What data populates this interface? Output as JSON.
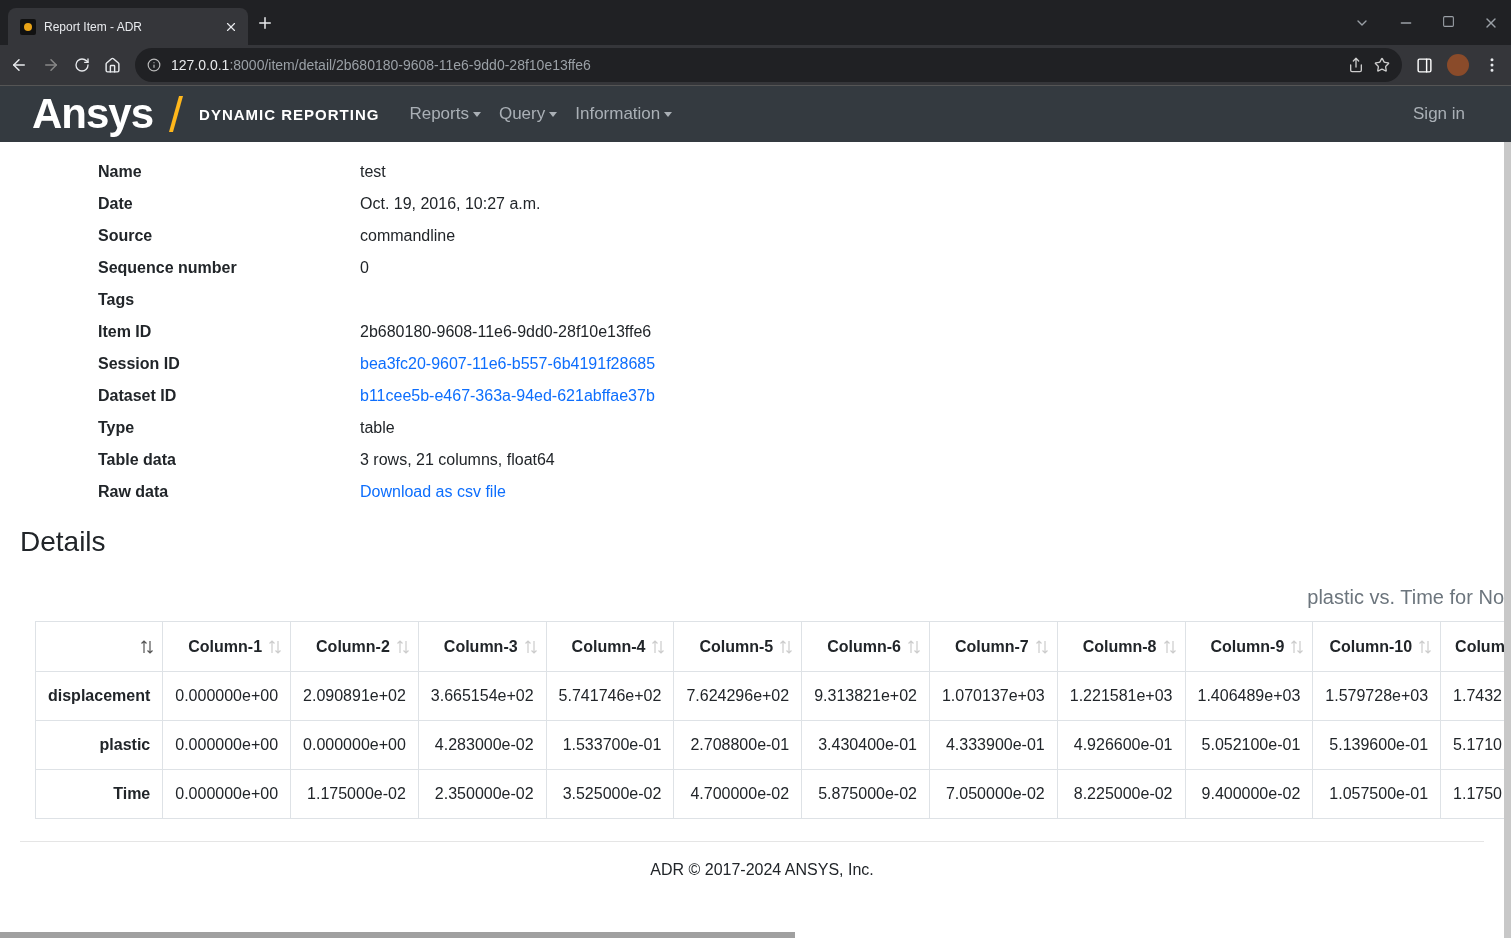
{
  "browser": {
    "tab_title": "Report Item - ADR",
    "url_host": "127.0.0.1",
    "url_path": ":8000/item/detail/2b680180-9608-11e6-9dd0-28f10e13ffe6"
  },
  "navbar": {
    "brand_word": "Ansys",
    "brand_sub": "DYNAMIC REPORTING",
    "menus": [
      "Reports",
      "Query",
      "Information"
    ],
    "sign_in": "Sign in"
  },
  "metadata": [
    {
      "label": "Name",
      "value": "test",
      "kind": "text"
    },
    {
      "label": "Date",
      "value": "Oct. 19, 2016, 10:27 a.m.",
      "kind": "text"
    },
    {
      "label": "Source",
      "value": "commandline",
      "kind": "text"
    },
    {
      "label": "Sequence number",
      "value": "0",
      "kind": "text"
    },
    {
      "label": "Tags"
    },
    {
      "label": "Item ID",
      "value": "2b680180-9608-11e6-9dd0-28f10e13ffe6",
      "kind": "text"
    },
    {
      "label": "Session ID",
      "value": "bea3fc20-9607-11e6-b557-6b4191f28685",
      "kind": "link"
    },
    {
      "label": "Dataset ID",
      "value": "b11cee5b-e467-363a-94ed-621abffae37b",
      "kind": "link"
    },
    {
      "label": "Type",
      "value": "table",
      "kind": "text"
    },
    {
      "label": "Table data",
      "value": "3 rows, 21 columns, float64",
      "kind": "text"
    },
    {
      "label": "Raw data",
      "value": "Download as csv file",
      "kind": "link"
    }
  ],
  "details_heading": "Details",
  "table": {
    "title": "plastic vs. Time for No",
    "columns": [
      "Column-1",
      "Column-2",
      "Column-3",
      "Column-4",
      "Column-5",
      "Column-6",
      "Column-7",
      "Column-8",
      "Column-9",
      "Column-10",
      "Colum"
    ],
    "rows": [
      {
        "label": "displacement",
        "cells": [
          "0.000000e+00",
          "2.090891e+02",
          "3.665154e+02",
          "5.741746e+02",
          "7.624296e+02",
          "9.313821e+02",
          "1.070137e+03",
          "1.221581e+03",
          "1.406489e+03",
          "1.579728e+03",
          "1.7432"
        ]
      },
      {
        "label": "plastic",
        "cells": [
          "0.000000e+00",
          "0.000000e+00",
          "4.283000e-02",
          "1.533700e-01",
          "2.708800e-01",
          "3.430400e-01",
          "4.333900e-01",
          "4.926600e-01",
          "5.052100e-01",
          "5.139600e-01",
          "5.1710"
        ]
      },
      {
        "label": "Time",
        "cells": [
          "0.000000e+00",
          "1.175000e-02",
          "2.350000e-02",
          "3.525000e-02",
          "4.700000e-02",
          "5.875000e-02",
          "7.050000e-02",
          "8.225000e-02",
          "9.400000e-02",
          "1.057500e-01",
          "1.1750"
        ]
      }
    ]
  },
  "footer": "ADR © 2017-2024 ANSYS, Inc."
}
